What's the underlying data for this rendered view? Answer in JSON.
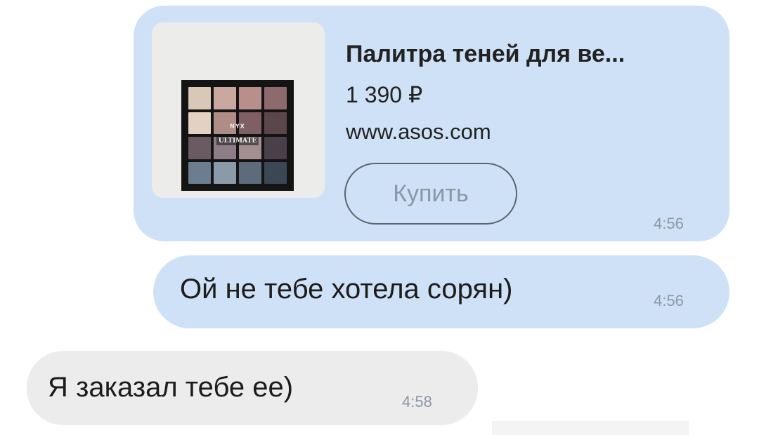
{
  "product_card": {
    "thumbnail": {
      "brand_text": "NYX",
      "product_text": "ULTIMATE",
      "pan_colors": [
        "#d9c7b8",
        "#c9a8a0",
        "#b98f8c",
        "#8d6a6e",
        "#e3d2c3",
        "#b08c86",
        "#7f5f63",
        "#5a464b",
        "#6a5a62",
        "#8e7d88",
        "#a48e92",
        "#4b4049",
        "#6c7d8f",
        "#8b9aa8",
        "#5d6b7a",
        "#3c4756"
      ]
    },
    "title": "Палитра теней для ве...",
    "price": "1 390 ₽",
    "url": "www.asos.com",
    "buy_label": "Купить",
    "time": "4:56"
  },
  "messages": [
    {
      "direction": "outgoing",
      "text": "Ой не тебе хотела сорян)",
      "time": "4:56"
    },
    {
      "direction": "incoming",
      "text": "Я заказал тебе ее)",
      "time": "4:58"
    }
  ],
  "colors": {
    "outgoing_bubble": "#cfe1f6",
    "incoming_bubble": "#ececec",
    "time_text": "#8c98a6"
  }
}
